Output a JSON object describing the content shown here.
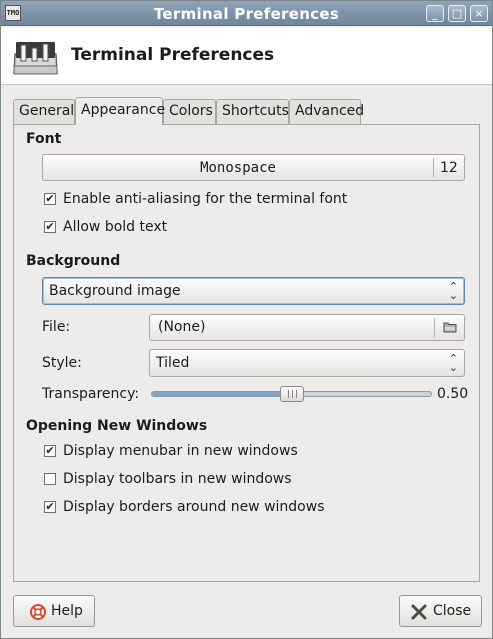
{
  "window": {
    "title": "Terminal Preferences",
    "app_icon_text": "TMO",
    "controls": {
      "minimize": "_",
      "maximize": "□",
      "close": "×"
    }
  },
  "header": {
    "title": "Terminal Preferences"
  },
  "tabs": [
    "General",
    "Appearance",
    "Colors",
    "Shortcuts",
    "Advanced"
  ],
  "active_tab": "Appearance",
  "font_section": {
    "heading": "Font",
    "font_name": "Monospace",
    "font_size": "12",
    "antialias_label": "Enable anti-aliasing for the terminal font",
    "antialias_checked": true,
    "bold_label": "Allow bold text",
    "bold_checked": true
  },
  "background_section": {
    "heading": "Background",
    "type_value": "Background image",
    "file_label": "File:",
    "file_value": "(None)",
    "style_label": "Style:",
    "style_value": "Tiled",
    "transparency_label": "Transparency:",
    "transparency_value": "0.50",
    "transparency_fraction": 0.5
  },
  "windows_section": {
    "heading": "Opening New Windows",
    "menubar_label": "Display menubar in new windows",
    "menubar_checked": true,
    "toolbars_label": "Display toolbars in new windows",
    "toolbars_checked": false,
    "borders_label": "Display borders around new windows",
    "borders_checked": true
  },
  "buttons": {
    "help": "Help",
    "close": "Close"
  },
  "colors": {
    "titlebar": "#7b90a5",
    "slider_fill": "#82a3c7",
    "help_icon": "#d9472b"
  },
  "glyphs": {
    "check": "✔",
    "combo_arrows": "⌃⌄"
  }
}
